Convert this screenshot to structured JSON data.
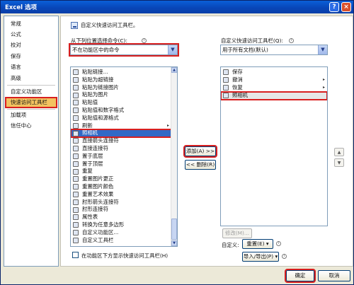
{
  "window": {
    "title": "Excel 选项",
    "help_label": "?",
    "close_label": "×"
  },
  "nav": {
    "items": [
      {
        "label": "常规"
      },
      {
        "label": "公式"
      },
      {
        "label": "校对"
      },
      {
        "label": "保存"
      },
      {
        "label": "语言"
      },
      {
        "label": "高级"
      },
      {
        "label": "自定义功能区"
      },
      {
        "label": "快速访问工具栏"
      },
      {
        "label": "加载项"
      },
      {
        "label": "信任中心"
      }
    ]
  },
  "main": {
    "heading": "自定义快速访问工具栏。",
    "choose_label": "从下列位置选择命令(C):",
    "choose_value": "不在功能区中的命令",
    "customize_label": "自定义快速访问工具栏(Q):",
    "customize_value": "用于所有文档(默认)",
    "commands": [
      {
        "label": "粘贴链接...",
        "arrow": ""
      },
      {
        "label": "粘贴为超链接",
        "arrow": ""
      },
      {
        "label": "粘贴为链接图片",
        "arrow": ""
      },
      {
        "label": "粘贴为图片",
        "arrow": ""
      },
      {
        "label": "粘贴值",
        "arrow": ""
      },
      {
        "label": "粘贴值和数字格式",
        "arrow": ""
      },
      {
        "label": "粘贴值和源格式",
        "arrow": ""
      },
      {
        "label": "刷新",
        "arrow": "▸"
      },
      {
        "label": "照相机",
        "arrow": ""
      },
      {
        "label": "直接箭头连接符",
        "arrow": ""
      },
      {
        "label": "直接连接符",
        "arrow": ""
      },
      {
        "label": "置于底层",
        "arrow": ""
      },
      {
        "label": "置于顶层",
        "arrow": ""
      },
      {
        "label": "重复",
        "arrow": ""
      },
      {
        "label": "重置图片更正",
        "arrow": ""
      },
      {
        "label": "重置图片颜色",
        "arrow": ""
      },
      {
        "label": "重置艺术效果",
        "arrow": ""
      },
      {
        "label": "肘形箭头连接符",
        "arrow": ""
      },
      {
        "label": "肘形连接符",
        "arrow": ""
      },
      {
        "label": "属性表",
        "arrow": ""
      },
      {
        "label": "转换为任意多边形",
        "arrow": ""
      },
      {
        "label": "自定义功能区...",
        "arrow": ""
      },
      {
        "label": "自定义工具栏",
        "arrow": ""
      }
    ],
    "selected_command_index": 8,
    "toolbar_items": [
      {
        "label": "保存",
        "arrow": ""
      },
      {
        "label": "撤消",
        "arrow": "▸"
      },
      {
        "label": "恢复",
        "arrow": "▸"
      },
      {
        "label": "照相机",
        "arrow": ""
      }
    ],
    "selected_toolbar_index": 3,
    "add_button": "添加(A) >>",
    "remove_button": "<< 删除(R)",
    "modify_button": "修改(M)...",
    "customize_text": "自定义:",
    "reset_button": "重置(E) ▾",
    "import_export_button": "导入/导出(P) ▾",
    "show_below_label": "在功能区下方显示快速访问工具栏(H)",
    "up_label": "▲",
    "down_label": "▼"
  },
  "footer": {
    "ok_label": "确定",
    "cancel_label": "取消"
  }
}
